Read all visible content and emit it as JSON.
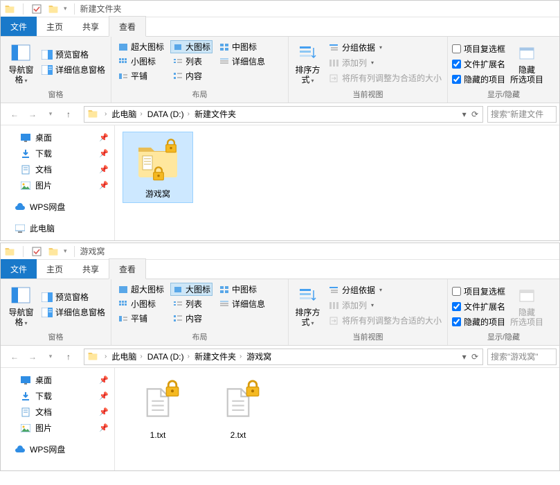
{
  "window1": {
    "title": "新建文件夹",
    "tabs": {
      "file": "文件",
      "home": "主页",
      "share": "共享",
      "view": "查看"
    },
    "ribbon": {
      "panes": {
        "nav": "导航窗格",
        "preview": "预览窗格",
        "details": "详细信息窗格",
        "group_label": "窗格"
      },
      "layout": {
        "extra_large": "超大图标",
        "large": "大图标",
        "medium": "中图标",
        "small": "小图标",
        "list": "列表",
        "details": "详细信息",
        "tiles": "平铺",
        "content": "内容",
        "group_label": "布局"
      },
      "currentview": {
        "sort": "排序方式",
        "groupby": "分组依据",
        "addcol": "添加列",
        "autosize": "将所有列调整为合适的大小",
        "group_label": "当前视图"
      },
      "showhide": {
        "checkboxes": "项目复选框",
        "extensions": "文件扩展名",
        "hidden": "隐藏的项目",
        "hide": "隐藏",
        "selected": "所选项目",
        "group_label": "显示/隐藏"
      }
    },
    "breadcrumb": [
      "此电脑",
      "DATA (D:)",
      "新建文件夹"
    ],
    "search_placeholder": "搜索\"新建文件",
    "nav": {
      "desktop": "桌面",
      "downloads": "下载",
      "documents": "文档",
      "pictures": "图片",
      "wps": "WPS网盘",
      "thispc": "此电脑"
    },
    "items": [
      {
        "name": "游戏窝",
        "type": "folder-locked",
        "selected": true
      }
    ]
  },
  "window2": {
    "title": "游戏窝",
    "tabs": {
      "file": "文件",
      "home": "主页",
      "share": "共享",
      "view": "查看"
    },
    "ribbon": {
      "panes": {
        "nav": "导航窗格",
        "preview": "预览窗格",
        "details": "详细信息窗格",
        "group_label": "窗格"
      },
      "layout": {
        "extra_large": "超大图标",
        "large": "大图标",
        "medium": "中图标",
        "small": "小图标",
        "list": "列表",
        "details": "详细信息",
        "tiles": "平铺",
        "content": "内容",
        "group_label": "布局"
      },
      "currentview": {
        "sort": "排序方式",
        "groupby": "分组依据",
        "addcol": "添加列",
        "autosize": "将所有列调整为合适的大小",
        "group_label": "当前视图"
      },
      "showhide": {
        "checkboxes": "项目复选框",
        "extensions": "文件扩展名",
        "hidden": "隐藏的项目",
        "hide": "隐藏",
        "selected": "所选项目",
        "group_label": "显示/隐藏"
      }
    },
    "breadcrumb": [
      "此电脑",
      "DATA (D:)",
      "新建文件夹",
      "游戏窝"
    ],
    "search_placeholder": "搜索\"游戏窝\"",
    "nav": {
      "desktop": "桌面",
      "downloads": "下载",
      "documents": "文档",
      "pictures": "图片",
      "wps": "WPS网盘"
    },
    "items": [
      {
        "name": "1.txt",
        "type": "file-locked",
        "selected": false
      },
      {
        "name": "2.txt",
        "type": "file-locked",
        "selected": false
      }
    ]
  }
}
